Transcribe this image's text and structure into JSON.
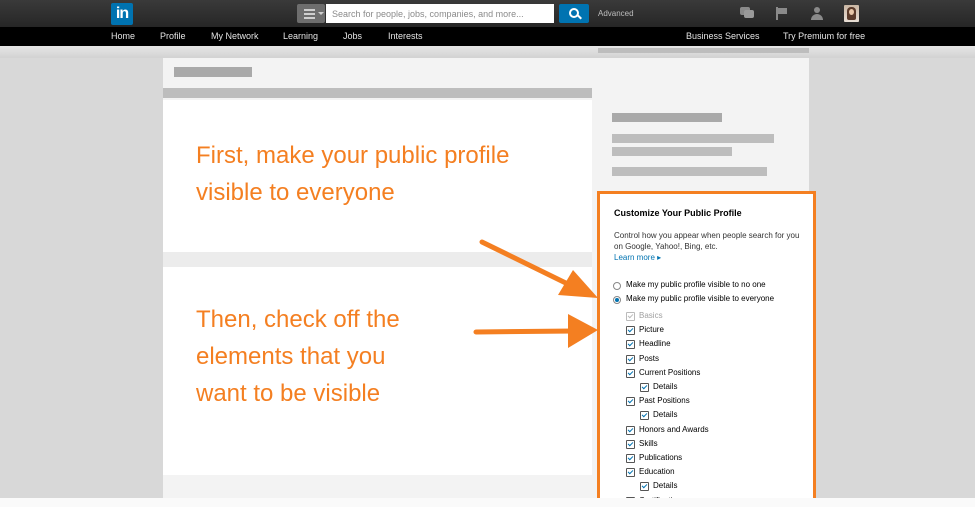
{
  "header": {
    "logo": "in",
    "search_placeholder": "Search for people, jobs, companies, and more...",
    "advanced": "Advanced"
  },
  "nav": {
    "items": [
      "Home",
      "Profile",
      "My Network",
      "Learning",
      "Jobs",
      "Interests"
    ],
    "business": "Business Services",
    "premium": "Try Premium for free"
  },
  "annotations": {
    "first": [
      "First, make your public profile",
      "visible to everyone"
    ],
    "then": [
      "Then, check off the",
      "elements that you",
      "want to be visible"
    ]
  },
  "panel": {
    "title": "Customize Your Public Profile",
    "description": "Control how you appear when people search for you on Google, Yahoo!, Bing, etc.",
    "learn_more": "Learn more ▸",
    "visibility": [
      {
        "label": "Make my public profile visible to no one",
        "selected": false
      },
      {
        "label": "Make my public profile visible to everyone",
        "selected": true
      }
    ],
    "sections": [
      {
        "label": "Basics",
        "checked": true,
        "disabled": true,
        "indent": 0
      },
      {
        "label": "Picture",
        "checked": true,
        "indent": 0
      },
      {
        "label": "Headline",
        "checked": true,
        "indent": 0
      },
      {
        "label": "Posts",
        "checked": true,
        "indent": 0
      },
      {
        "label": "Current Positions",
        "checked": true,
        "indent": 0
      },
      {
        "label": "Details",
        "checked": true,
        "indent": 1
      },
      {
        "label": "Past Positions",
        "checked": true,
        "indent": 0
      },
      {
        "label": "Details",
        "checked": true,
        "indent": 1
      },
      {
        "label": "Honors and Awards",
        "checked": true,
        "indent": 0
      },
      {
        "label": "Skills",
        "checked": true,
        "indent": 0
      },
      {
        "label": "Publications",
        "checked": true,
        "indent": 0
      },
      {
        "label": "Education",
        "checked": true,
        "indent": 0
      },
      {
        "label": "Details",
        "checked": true,
        "indent": 1
      },
      {
        "label": "Certifications",
        "checked": true,
        "indent": 0
      }
    ]
  },
  "colors": {
    "accent": "#f47f21",
    "linkedin_blue": "#0073b1"
  }
}
